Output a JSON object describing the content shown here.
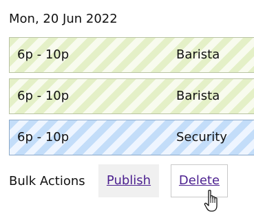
{
  "date_header": "Mon, 20 Jun 2022",
  "shifts": [
    {
      "time": "6p - 10p",
      "role": "Barista",
      "color": "#e4f0c7"
    },
    {
      "time": "6p - 10p",
      "role": "Barista",
      "color": "#e4f0c7"
    },
    {
      "time": "6p - 10p",
      "role": "Security",
      "color": "#c3ddf9"
    }
  ],
  "bulk_actions": {
    "label": "Bulk Actions",
    "publish_label": "Publish",
    "delete_label": "Delete"
  },
  "colors": {
    "link": "#4b1f8f",
    "barista_stripe": "#e4f0c7",
    "security_stripe": "#c3ddf9"
  },
  "cursor_icon": "hand-pointer-icon"
}
